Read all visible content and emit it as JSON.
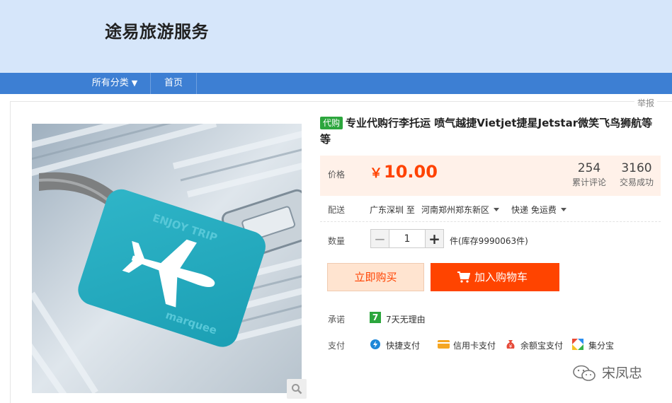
{
  "header": {
    "shop_name": "途易旅游服务"
  },
  "nav": {
    "items": [
      {
        "label": "所有分类",
        "has_dropdown": true
      },
      {
        "label": "首页"
      }
    ]
  },
  "report_label": "举报",
  "product": {
    "badge": "代购",
    "title": "专业代购行李托运 喷气越捷Vietjet捷星Jetstar微笑飞鸟狮航等等",
    "price_label": "价格",
    "currency": "￥",
    "price": "10.00",
    "stats": [
      {
        "value": "254",
        "label": "累计评论"
      },
      {
        "value": "3160",
        "label": "交易成功"
      }
    ],
    "shipping": {
      "label": "配送",
      "from": "广东深圳",
      "to_word": "至",
      "to": "河南郑州郑东新区",
      "method": "快递 免运费"
    },
    "quantity": {
      "label": "数量",
      "value": "1",
      "minus": "−",
      "plus": "+",
      "stock_text": "件(库存9990063件)"
    },
    "buttons": {
      "buy_now": "立即购买",
      "add_cart": "加入购物车"
    },
    "promise": {
      "label": "承诺",
      "icon_text": "7",
      "text": "7天无理由"
    },
    "payment": {
      "label": "支付",
      "methods": [
        "快捷支付",
        "信用卡支付",
        "余额宝支付",
        "集分宝"
      ]
    }
  },
  "watermark": {
    "text": "宋凤忠"
  },
  "colors": {
    "header_bg": "#d6e6fa",
    "nav_bg": "#3d7fd3",
    "price": "#ff4200",
    "cart_button": "#ff4400",
    "badge": "#2ca63d"
  }
}
